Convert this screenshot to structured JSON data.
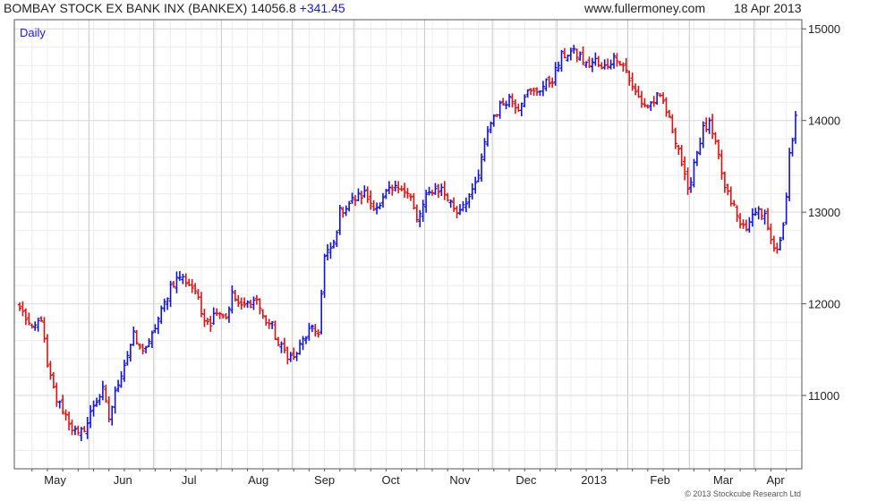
{
  "header": {
    "title": "BOMBAY STOCK EX BANK INX (BANKEX)",
    "last": "14056.8",
    "change": "+341.45",
    "site": "www.fullermoney.com",
    "date": "18 Apr 2013"
  },
  "copyright": "© 2013 Stockcube Research Ltd",
  "colors": {
    "up": "#1010e0",
    "down": "#e01010",
    "grid": "#d9d9d9",
    "axis": "#555555"
  },
  "chart_data": {
    "type": "candlestick",
    "period_label": "Daily",
    "y_axis": {
      "side": "right",
      "ylim": [
        10200,
        15100
      ],
      "ticks": [
        11000,
        12000,
        13000,
        14000,
        15000
      ]
    },
    "x_axis": {
      "labels": [
        "May",
        "Jun",
        "Jul",
        "Aug",
        "Sep",
        "Oct",
        "Nov",
        "Dec",
        "2013",
        "Feb",
        "Mar",
        "Apr"
      ]
    },
    "grid": true,
    "legend": "none",
    "series": [
      {
        "name": "BANKEX",
        "close_path": [
          [
            "2012-05-01",
            11950
          ],
          [
            "2012-05-03",
            11850
          ],
          [
            "2012-05-07",
            11700
          ],
          [
            "2012-05-10",
            11850
          ],
          [
            "2012-05-14",
            11300
          ],
          [
            "2012-05-17",
            10950
          ],
          [
            "2012-05-21",
            10850
          ],
          [
            "2012-05-24",
            10650
          ],
          [
            "2012-05-28",
            10550
          ],
          [
            "2012-05-31",
            10700
          ],
          [
            "2012-06-04",
            10900
          ],
          [
            "2012-06-07",
            11050
          ],
          [
            "2012-06-11",
            10750
          ],
          [
            "2012-06-14",
            11150
          ],
          [
            "2012-06-18",
            11350
          ],
          [
            "2012-06-21",
            11650
          ],
          [
            "2012-06-25",
            11500
          ],
          [
            "2012-06-28",
            11550
          ],
          [
            "2012-07-02",
            11750
          ],
          [
            "2012-07-05",
            12000
          ],
          [
            "2012-07-09",
            12200
          ],
          [
            "2012-07-12",
            12300
          ],
          [
            "2012-07-16",
            12250
          ],
          [
            "2012-07-19",
            12150
          ],
          [
            "2012-07-23",
            11900
          ],
          [
            "2012-07-26",
            11800
          ],
          [
            "2012-07-30",
            11950
          ],
          [
            "2012-08-02",
            11850
          ],
          [
            "2012-08-06",
            12100
          ],
          [
            "2012-08-09",
            11950
          ],
          [
            "2012-08-13",
            12000
          ],
          [
            "2012-08-16",
            12050
          ],
          [
            "2012-08-20",
            11850
          ],
          [
            "2012-08-23",
            11750
          ],
          [
            "2012-08-27",
            11550
          ],
          [
            "2012-08-30",
            11450
          ],
          [
            "2012-09-03",
            11400
          ],
          [
            "2012-09-06",
            11600
          ],
          [
            "2012-09-10",
            11700
          ],
          [
            "2012-09-13",
            11700
          ],
          [
            "2012-09-14",
            12100
          ],
          [
            "2012-09-17",
            12500
          ],
          [
            "2012-09-20",
            12650
          ],
          [
            "2012-09-24",
            13000
          ],
          [
            "2012-09-27",
            13100
          ],
          [
            "2012-10-01",
            13150
          ],
          [
            "2012-10-04",
            13200
          ],
          [
            "2012-10-08",
            13100
          ],
          [
            "2012-10-11",
            13050
          ],
          [
            "2012-10-15",
            13200
          ],
          [
            "2012-10-18",
            13250
          ],
          [
            "2012-10-22",
            13300
          ],
          [
            "2012-10-25",
            13150
          ],
          [
            "2012-10-29",
            12900
          ],
          [
            "2012-11-01",
            13150
          ],
          [
            "2012-11-05",
            13250
          ],
          [
            "2012-11-08",
            13250
          ],
          [
            "2012-11-12",
            13150
          ],
          [
            "2012-11-15",
            13000
          ],
          [
            "2012-11-19",
            13100
          ],
          [
            "2012-11-22",
            13200
          ],
          [
            "2012-11-26",
            13400
          ],
          [
            "2012-11-29",
            13900
          ],
          [
            "2012-12-03",
            14050
          ],
          [
            "2012-12-06",
            14200
          ],
          [
            "2012-12-10",
            14250
          ],
          [
            "2012-12-13",
            14150
          ],
          [
            "2012-12-17",
            14300
          ],
          [
            "2012-12-20",
            14300
          ],
          [
            "2012-12-24",
            14350
          ],
          [
            "2012-12-28",
            14450
          ],
          [
            "2013-01-02",
            14700
          ],
          [
            "2013-01-07",
            14750
          ],
          [
            "2013-01-10",
            14700
          ],
          [
            "2013-01-14",
            14600
          ],
          [
            "2013-01-17",
            14650
          ],
          [
            "2013-01-21",
            14550
          ],
          [
            "2013-01-24",
            14650
          ],
          [
            "2013-01-28",
            14700
          ],
          [
            "2013-01-31",
            14550
          ],
          [
            "2013-02-04",
            14350
          ],
          [
            "2013-02-07",
            14200
          ],
          [
            "2013-02-11",
            14150
          ],
          [
            "2013-02-14",
            14250
          ],
          [
            "2013-02-18",
            14200
          ],
          [
            "2013-02-21",
            13900
          ],
          [
            "2013-02-25",
            13700
          ],
          [
            "2013-02-28",
            13200
          ],
          [
            "2013-03-04",
            13550
          ],
          [
            "2013-03-07",
            13900
          ],
          [
            "2013-03-11",
            13950
          ],
          [
            "2013-03-14",
            13600
          ],
          [
            "2013-03-18",
            13250
          ],
          [
            "2013-03-21",
            13050
          ],
          [
            "2013-03-25",
            12850
          ],
          [
            "2013-03-28",
            12850
          ],
          [
            "2013-04-01",
            13050
          ],
          [
            "2013-04-04",
            12950
          ],
          [
            "2013-04-08",
            12650
          ],
          [
            "2013-04-10",
            12550
          ],
          [
            "2013-04-12",
            12900
          ],
          [
            "2013-04-15",
            13200
          ],
          [
            "2013-04-16",
            13600
          ],
          [
            "2013-04-17",
            13750
          ],
          [
            "2013-04-18",
            14056.8
          ]
        ]
      }
    ]
  }
}
